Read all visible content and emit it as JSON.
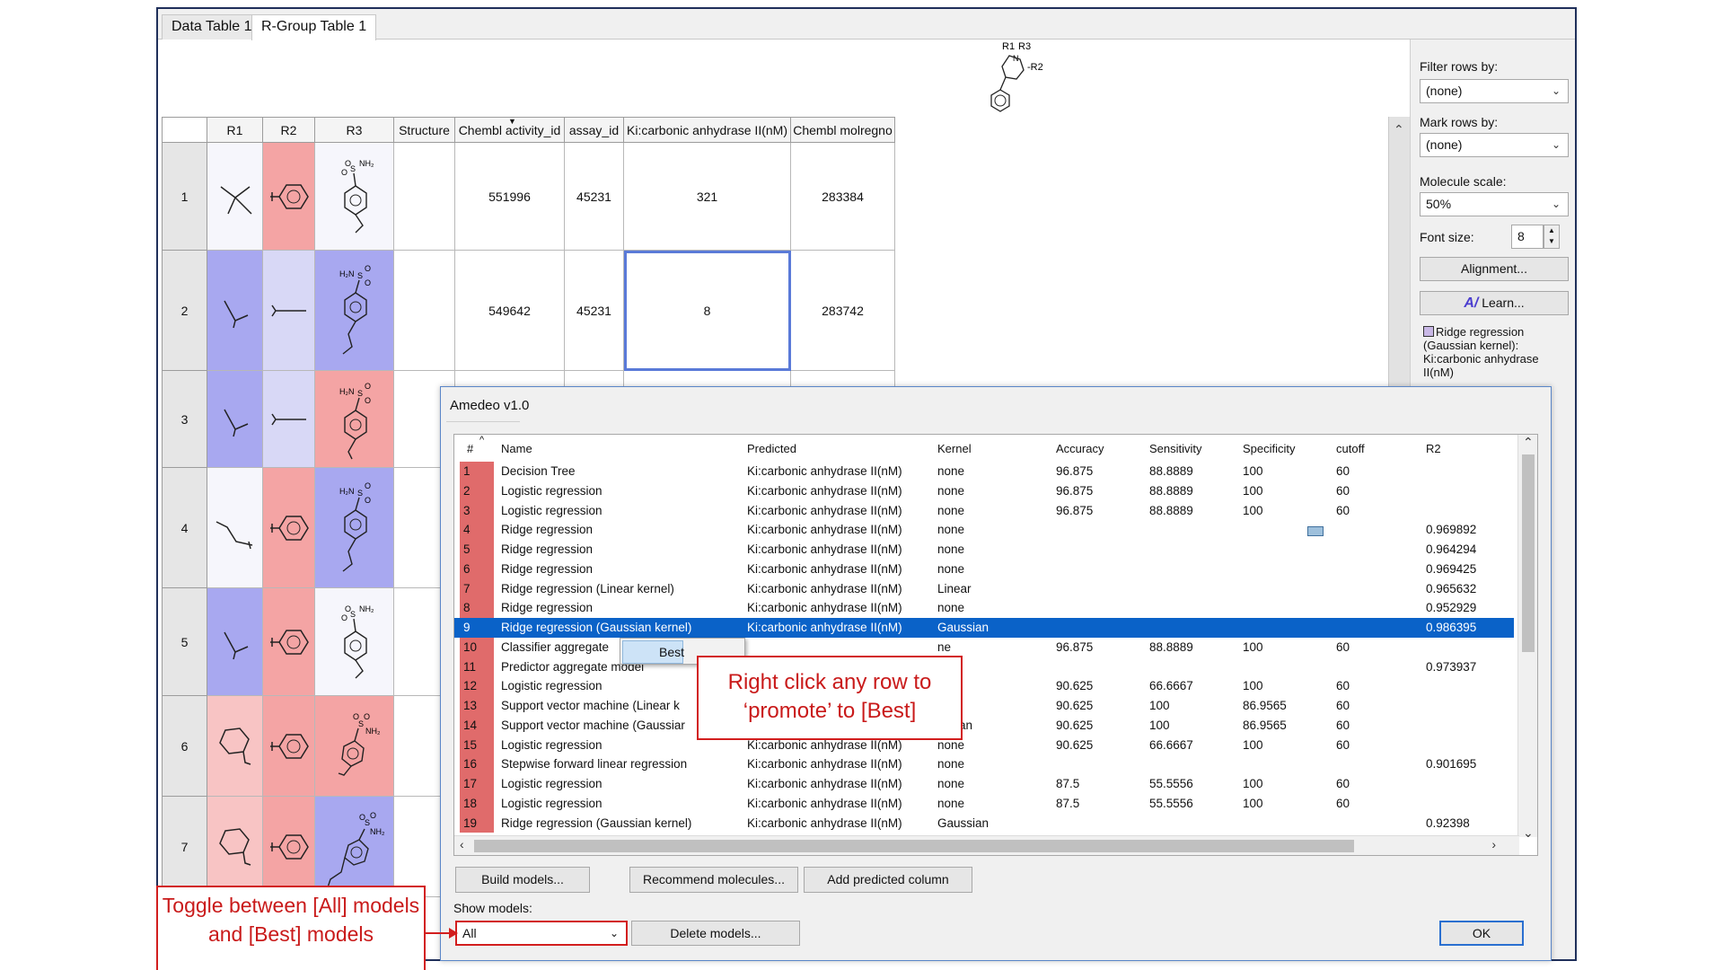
{
  "tabs": [
    {
      "label": "Data Table 1"
    },
    {
      "label": "R-Group Table 1"
    }
  ],
  "core_labels": {
    "r1": "R1",
    "r3": "R3",
    "r2": "-R2",
    "n": "N"
  },
  "table": {
    "headers": [
      "R1",
      "R2",
      "R3",
      "Structure",
      "Chembl activity_id",
      "assay_id",
      "Ki:carbonic anhydrase II(nM)",
      "Chembl molregno"
    ],
    "rows": [
      {
        "index": "1",
        "activity_id": "551996",
        "assay_id": "45231",
        "ki": "321",
        "molregno": "283384"
      },
      {
        "index": "2",
        "activity_id": "549642",
        "assay_id": "45231",
        "ki": "8",
        "molregno": "283742"
      },
      {
        "index": "3"
      },
      {
        "index": "4"
      },
      {
        "index": "5"
      },
      {
        "index": "6"
      },
      {
        "index": "7"
      }
    ],
    "colors": {
      "white": "#f6f6fc",
      "light_blue": "#d8d8f6",
      "blue": "#a8a8f0",
      "pink": "#f8c4c4",
      "red": "#f4a4a4"
    }
  },
  "panel": {
    "filter_label": "Filter rows by:",
    "filter_value": "(none)",
    "mark_label": "Mark rows by:",
    "mark_value": "(none)",
    "scale_label": "Molecule scale:",
    "scale_value": "50%",
    "font_label": "Font size:",
    "font_value": "8",
    "alignment_button": "Alignment...",
    "learn_button": "Learn...",
    "legend": "Ridge regression (Gaussian kernel): Ki:carbonic anhydrase II(nM)"
  },
  "dialog": {
    "title": "Amedeo v1.0",
    "columns": [
      "#",
      "Name",
      "Predicted",
      "Kernel",
      "Accuracy",
      "Sensitivity",
      "Specificity",
      "cutoff",
      "R2"
    ],
    "models": [
      {
        "n": "1",
        "name": "Decision Tree",
        "pred": "Ki:carbonic anhydrase II(nM)",
        "kernel": "none",
        "acc": "96.875",
        "sens": "88.8889",
        "spec": "100",
        "cut": "60",
        "r2": ""
      },
      {
        "n": "2",
        "name": "Logistic regression",
        "pred": "Ki:carbonic anhydrase II(nM)",
        "kernel": "none",
        "acc": "96.875",
        "sens": "88.8889",
        "spec": "100",
        "cut": "60",
        "r2": ""
      },
      {
        "n": "3",
        "name": "Logistic regression",
        "pred": "Ki:carbonic anhydrase II(nM)",
        "kernel": "none",
        "acc": "96.875",
        "sens": "88.8889",
        "spec": "100",
        "cut": "60",
        "r2": ""
      },
      {
        "n": "4",
        "name": "Ridge regression",
        "pred": "Ki:carbonic anhydrase II(nM)",
        "kernel": "none",
        "acc": "",
        "sens": "",
        "spec": "",
        "cut": "",
        "r2": "0.969892"
      },
      {
        "n": "5",
        "name": "Ridge regression",
        "pred": "Ki:carbonic anhydrase II(nM)",
        "kernel": "none",
        "acc": "",
        "sens": "",
        "spec": "",
        "cut": "",
        "r2": "0.964294"
      },
      {
        "n": "6",
        "name": "Ridge regression",
        "pred": "Ki:carbonic anhydrase II(nM)",
        "kernel": "none",
        "acc": "",
        "sens": "",
        "spec": "",
        "cut": "",
        "r2": "0.969425"
      },
      {
        "n": "7",
        "name": "Ridge regression (Linear kernel)",
        "pred": "Ki:carbonic anhydrase II(nM)",
        "kernel": "Linear",
        "acc": "",
        "sens": "",
        "spec": "",
        "cut": "",
        "r2": "0.965632"
      },
      {
        "n": "8",
        "name": "Ridge regression",
        "pred": "Ki:carbonic anhydrase II(nM)",
        "kernel": "none",
        "acc": "",
        "sens": "",
        "spec": "",
        "cut": "",
        "r2": "0.952929"
      },
      {
        "n": "9",
        "name": "Ridge regression (Gaussian kernel)",
        "pred": "Ki:carbonic anhydrase II(nM)",
        "kernel": "Gaussian",
        "acc": "",
        "sens": "",
        "spec": "",
        "cut": "",
        "r2": "0.986395"
      },
      {
        "n": "10",
        "name": "Classifier aggregate",
        "pred": "",
        "kernel": "ne",
        "acc": "96.875",
        "sens": "88.8889",
        "spec": "100",
        "cut": "60",
        "r2": ""
      },
      {
        "n": "11",
        "name": "Predictor aggregate model",
        "pred": "",
        "kernel": "ne",
        "acc": "",
        "sens": "",
        "spec": "",
        "cut": "",
        "r2": "0.973937"
      },
      {
        "n": "12",
        "name": "Logistic regression",
        "pred": "",
        "kernel": "ne",
        "acc": "90.625",
        "sens": "66.6667",
        "spec": "100",
        "cut": "60",
        "r2": ""
      },
      {
        "n": "13",
        "name": "Support vector machine (Linear k",
        "pred": "",
        "kernel": "ear",
        "acc": "90.625",
        "sens": "100",
        "spec": "86.9565",
        "cut": "60",
        "r2": ""
      },
      {
        "n": "14",
        "name": "Support vector machine (Gaussiar",
        "pred": "",
        "kernel": "ussian",
        "acc": "90.625",
        "sens": "100",
        "spec": "86.9565",
        "cut": "60",
        "r2": ""
      },
      {
        "n": "15",
        "name": "Logistic regression",
        "pred": "Ki:carbonic anhydrase II(nM)",
        "kernel": "none",
        "acc": "90.625",
        "sens": "66.6667",
        "spec": "100",
        "cut": "60",
        "r2": ""
      },
      {
        "n": "16",
        "name": "Stepwise forward linear regression",
        "pred": "Ki:carbonic anhydrase II(nM)",
        "kernel": "none",
        "acc": "",
        "sens": "",
        "spec": "",
        "cut": "",
        "r2": "0.901695"
      },
      {
        "n": "17",
        "name": "Logistic regression",
        "pred": "Ki:carbonic anhydrase II(nM)",
        "kernel": "none",
        "acc": "87.5",
        "sens": "55.5556",
        "spec": "100",
        "cut": "60",
        "r2": ""
      },
      {
        "n": "18",
        "name": "Logistic regression",
        "pred": "Ki:carbonic anhydrase II(nM)",
        "kernel": "none",
        "acc": "87.5",
        "sens": "55.5556",
        "spec": "100",
        "cut": "60",
        "r2": ""
      },
      {
        "n": "19",
        "name": "Ridge regression (Gaussian kernel)",
        "pred": "Ki:carbonic anhydrase II(nM)",
        "kernel": "Gaussian",
        "acc": "",
        "sens": "",
        "spec": "",
        "cut": "",
        "r2": "0.92398"
      }
    ],
    "highlight_row_color": "#0a62c8",
    "index_cell_color": "#e06b6b",
    "build_button": "Build models...",
    "recommend_button": "Recommend molecules...",
    "add_column_button": "Add predicted column",
    "show_label": "Show models:",
    "show_value": "All",
    "delete_button": "Delete models...",
    "ok_button": "OK"
  },
  "context_menu": {
    "item": "Best"
  },
  "annotations": {
    "callout_right_click": "Right click any row to ‘promote’ to [Best]",
    "callout_toggle": "Toggle between [All] models and [Best] models",
    "annotation_color": "#d21e1e"
  }
}
